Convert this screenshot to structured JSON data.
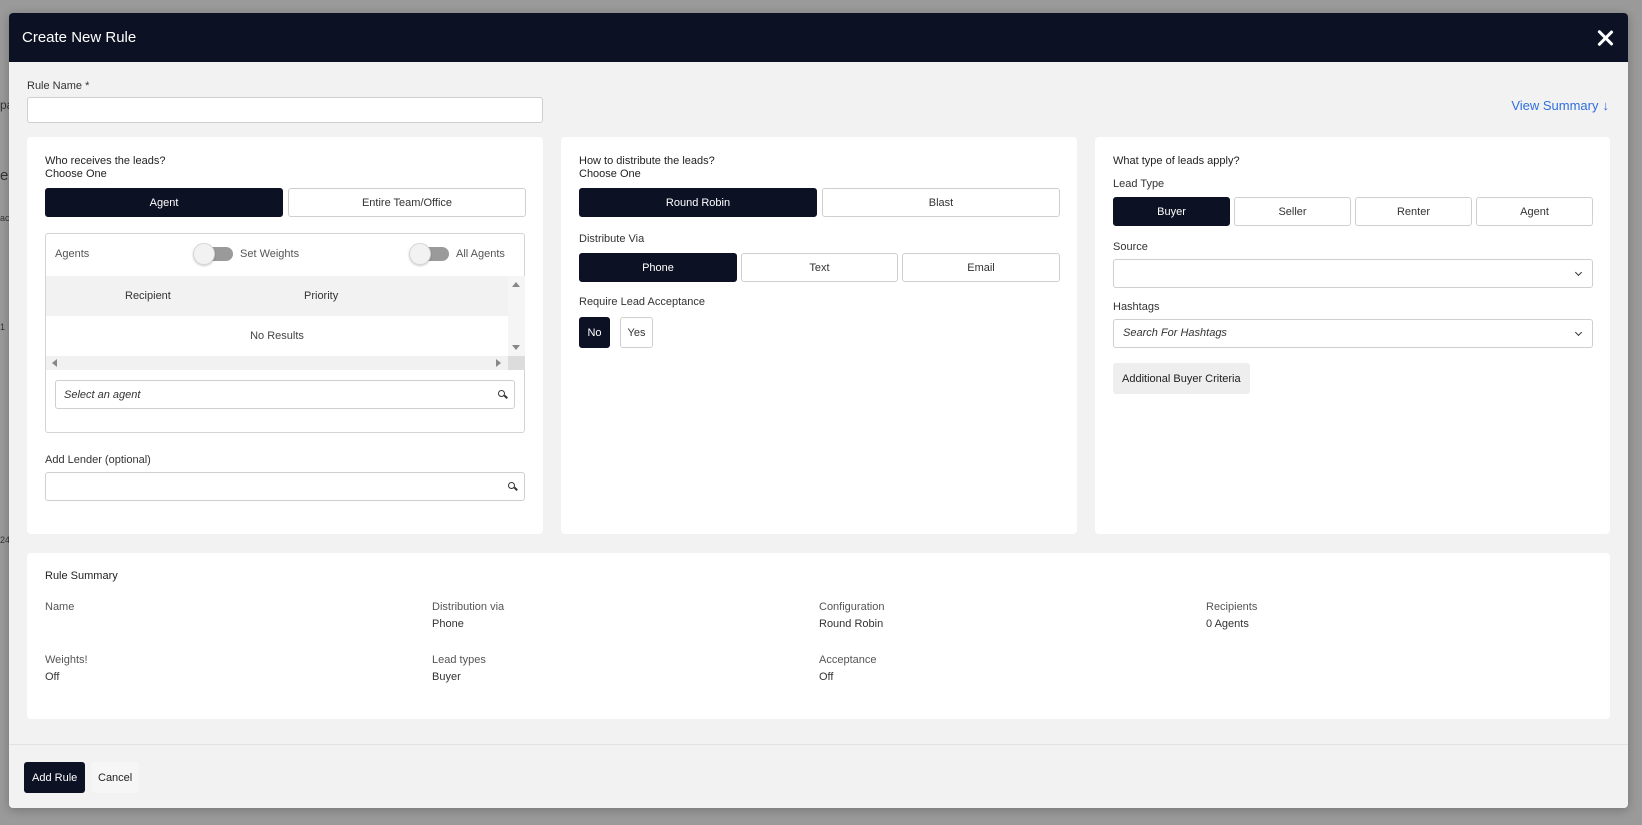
{
  "modal": {
    "title": "Create New Rule",
    "close_label": "✕"
  },
  "rule_name": {
    "label": "Rule Name *",
    "value": "",
    "placeholder": ""
  },
  "view_summary": {
    "label": "View Summary",
    "arrow": "↓"
  },
  "receivers": {
    "title": "Who receives the leads?",
    "subtitle": "Choose One",
    "options": [
      "Agent",
      "Entire Team/Office"
    ],
    "selected": "Agent",
    "agents_label": "Agents",
    "set_weights_label": "Set Weights",
    "set_weights_on": false,
    "all_agents_label": "All Agents",
    "all_agents_on": false,
    "columns": [
      "Recipient",
      "Priority"
    ],
    "empty_text": "No Results",
    "agent_search_placeholder": "Select an agent",
    "lender_label": "Add Lender (optional)",
    "lender_placeholder": ""
  },
  "distribution": {
    "title": "How to distribute the leads?",
    "subtitle": "Choose One",
    "options": [
      "Round Robin",
      "Blast"
    ],
    "selected": "Round Robin",
    "via_label": "Distribute Via",
    "via_options": [
      "Phone",
      "Text",
      "Email"
    ],
    "via_selected": "Phone",
    "acceptance_label": "Require Lead Acceptance",
    "acceptance_options": [
      "No",
      "Yes"
    ],
    "acceptance_selected": "No"
  },
  "lead_types": {
    "title": "What type of leads apply?",
    "type_label": "Lead Type",
    "options": [
      "Buyer",
      "Seller",
      "Renter",
      "Agent"
    ],
    "selected": "Buyer",
    "source_label": "Source",
    "source_value": "",
    "hashtags_label": "Hashtags",
    "hashtags_placeholder": "Search For Hashtags",
    "criteria_button": "Additional Buyer Criteria"
  },
  "summary": {
    "title": "Rule Summary",
    "items": [
      {
        "key": "Name",
        "value": ""
      },
      {
        "key": "Distribution via",
        "value": "Phone"
      },
      {
        "key": "Configuration",
        "value": "Round Robin"
      },
      {
        "key": "Recipients",
        "value": "0 Agents"
      },
      {
        "key": "Weights!",
        "value": "Off"
      },
      {
        "key": "Lead types",
        "value": "Buyer"
      },
      {
        "key": "Acceptance",
        "value": "Off"
      }
    ]
  },
  "footer": {
    "add_label": "Add Rule",
    "cancel_label": "Cancel"
  },
  "backdrop": {
    "fragments": [
      "pa",
      "ea",
      "ac",
      "1",
      "24"
    ]
  },
  "colors": {
    "primary_dark": "#0d1124",
    "link_blue": "#2f6fe0",
    "modal_bg": "#f2f2f2",
    "toggle_off": "#9a9a9a"
  }
}
